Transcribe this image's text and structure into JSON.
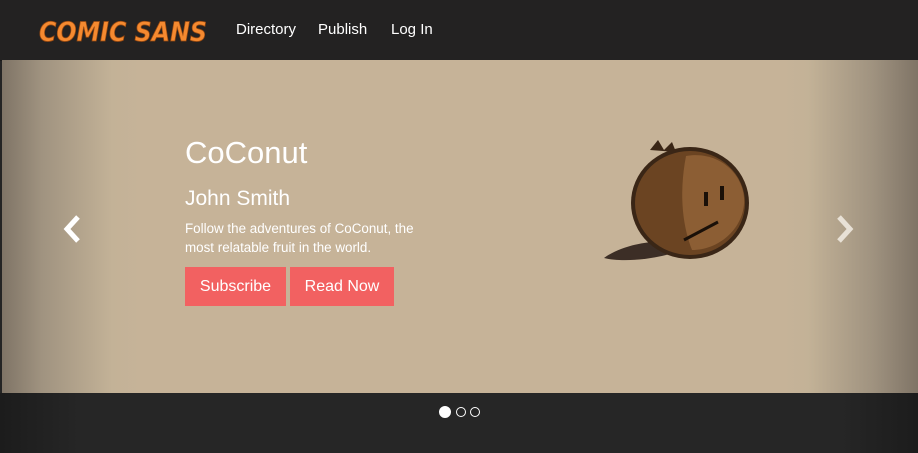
{
  "brand": {
    "logo_text": "COMIC SANS",
    "logo_color": "#f58a30"
  },
  "nav": {
    "items": [
      {
        "label": "Directory"
      },
      {
        "label": "Publish"
      },
      {
        "label": "Log In"
      }
    ]
  },
  "carousel": {
    "slide": {
      "title": "CoConut",
      "author": "John Smith",
      "description": "Follow the adventures of CoConut, the most relatable fruit in the world.",
      "subscribe_label": "Subscribe",
      "read_label": "Read Now",
      "image": "coconut-character-illustration"
    },
    "prev_icon": "chevron-left-icon",
    "next_icon": "chevron-right-icon",
    "indicators": {
      "count": 3,
      "active_index": 0
    }
  },
  "colors": {
    "navbar_bg": "#232222",
    "slide_bg": "#c6b398",
    "button_bg": "#f26161",
    "text": "#ffffff"
  }
}
